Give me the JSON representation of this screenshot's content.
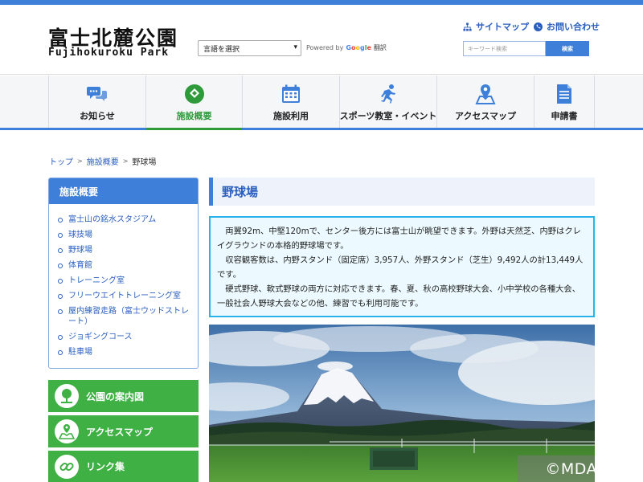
{
  "header": {
    "logo_jp": "富士北麓公園",
    "logo_en": "Fujihokuroku Park",
    "language_select": "言語を選択",
    "powered_by": "Powered by",
    "google": [
      "G",
      "o",
      "o",
      "g",
      "l",
      "e"
    ],
    "translate": "翻訳",
    "sitemap_label": "サイトマップ",
    "contact_label": "お問い合わせ",
    "search_placeholder": "キーワード検索",
    "search_button": "検索"
  },
  "nav": {
    "items": [
      {
        "label": "お知らせ",
        "icon": "chat-bubbles-icon"
      },
      {
        "label": "施設概要",
        "icon": "baseball-field-icon"
      },
      {
        "label": "施設利用",
        "icon": "calendar-icon"
      },
      {
        "label": "スポーツ教室・イベント",
        "icon": "runner-icon"
      },
      {
        "label": "アクセスマップ",
        "icon": "map-pin-icon"
      },
      {
        "label": "申請書",
        "icon": "document-icon"
      }
    ],
    "active_index": 1
  },
  "breadcrumb": {
    "home": "トップ",
    "parent": "施設概要",
    "current": "野球場",
    "separator": ">"
  },
  "sidebar": {
    "heading": "施設概要",
    "items": [
      "富士山の銘水スタジアム",
      "球技場",
      "野球場",
      "体育館",
      "トレーニング室",
      "フリーウエイトトレーニング室",
      "屋内練習走路（富士ウッドストレート）",
      "ジョギングコース",
      "駐車場"
    ],
    "buttons": [
      {
        "label": "公園の案内図",
        "icon": "park-tree-icon"
      },
      {
        "label": "アクセスマップ",
        "icon": "map-icon"
      },
      {
        "label": "リンク集",
        "icon": "link-chain-icon"
      }
    ]
  },
  "main": {
    "title": "野球場",
    "paragraphs": [
      "両翼92m、中堅120mで、センター後方には富士山が眺望できます。外野は天然芝、内野はクレイグラウンドの本格的野球場です。",
      "収容観客数は、内野スタンド（固定席）3,957人、外野スタンド（芝生）9,492人の計13,449人です。",
      "硬式野球、軟式野球の両方に対応できます。春、夏、秋の高校野球大会、小中学校の各種大会、一般社会人野球大会などの他、練習でも利用可能です。"
    ],
    "copyright": "©MDATA"
  },
  "colors": {
    "primary_blue": "#3d7fd9",
    "active_green": "#2e9a3a",
    "button_green": "#3eb044",
    "info_border": "#29b3e8"
  }
}
